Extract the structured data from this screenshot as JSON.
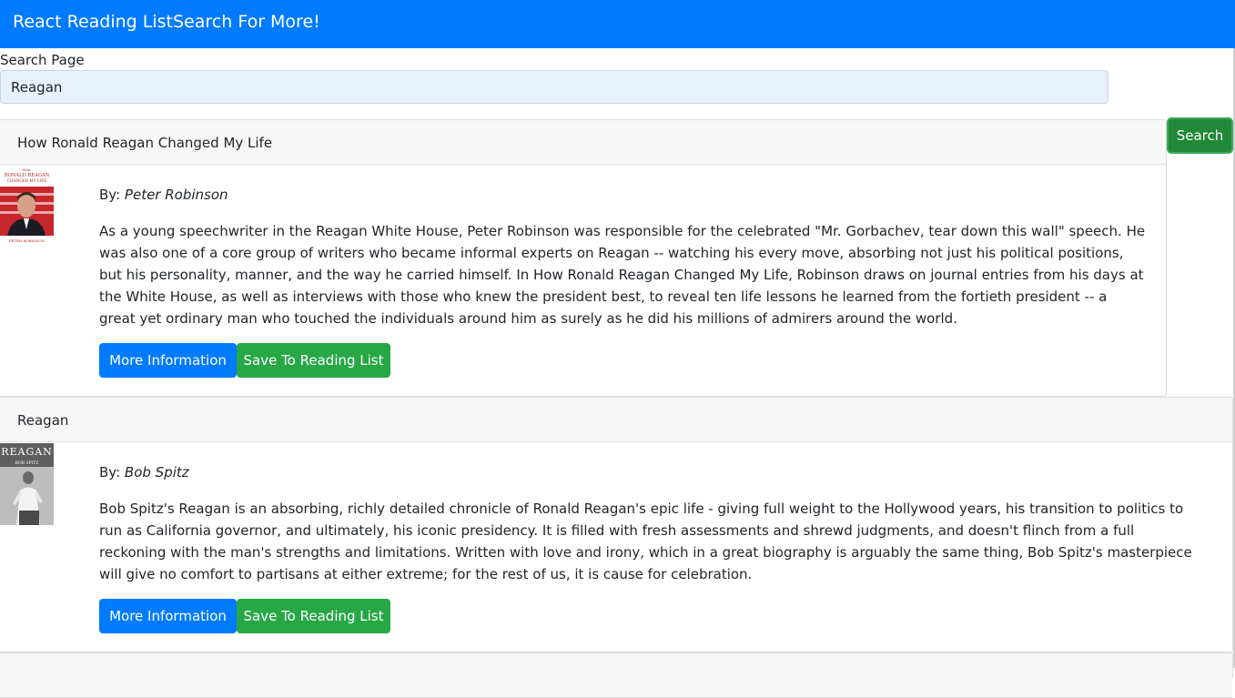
{
  "navbar": {
    "brand": "React Reading List",
    "link": "Search For More!"
  },
  "search": {
    "label": "Search Page",
    "value": "Reagan",
    "button": "Search"
  },
  "results": [
    {
      "title": "How Ronald Reagan Changed My Life",
      "by_label": "By:",
      "author": "Peter Robinson",
      "description": "As a young speechwriter in the Reagan White House, Peter Robinson was responsible for the celebrated \"Mr. Gorbachev, tear down this wall\" speech. He was also one of a core group of writers who became informal experts on Reagan -- watching his every move, absorbing not just his political positions, but his personality, manner, and the way he carried himself. In How Ronald Reagan Changed My Life, Robinson draws on journal entries from his days at the White House, as well as interviews with those who knew the president best, to reveal ten life lessons he learned from the fortieth president -- a great yet ordinary man who touched the individuals around him as surely as he did his millions of admirers around the world.",
      "cover": {
        "line1": "How",
        "line2": "RONALD REAGAN",
        "line3": "CHANGED MY LIFE",
        "author": "PETER ROBINSON"
      },
      "more_info": "More Information",
      "save": "Save To Reading List"
    },
    {
      "title": "Reagan",
      "by_label": "By:",
      "author": "Bob Spitz",
      "description": "Bob Spitz's Reagan is an absorbing, richly detailed chronicle of Ronald Reagan's epic life - giving full weight to the Hollywood years, his transition to politics to run as California governor, and ultimately, his iconic presidency. It is filled with fresh assessments and shrewd judgments, and doesn't flinch from a full reckoning with the man's strengths and limitations. Written with love and irony, which in a great biography is arguably the same thing, Bob Spitz's masterpiece will give no comfort to partisans at either extreme; for the rest of us, it is cause for celebration.",
      "cover": {
        "line1": "REAGAN",
        "author": "BOB SPITZ"
      },
      "more_info": "More Information",
      "save": "Save To Reading List"
    }
  ],
  "colors": {
    "navbar": "#007bff",
    "info_button": "#007bff",
    "save_button": "#28a745",
    "search_button": "#218838"
  }
}
